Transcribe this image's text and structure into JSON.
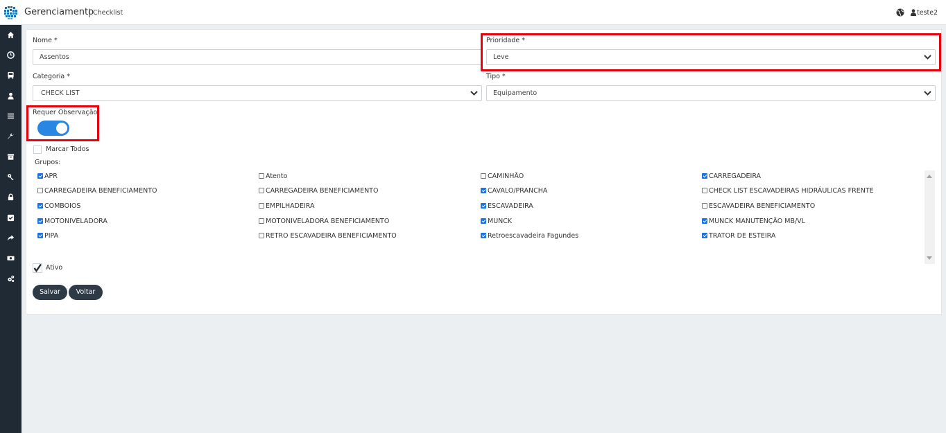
{
  "header": {
    "app_title": "Gerenciamento",
    "separator": "|",
    "breadcrumb": "Checklist",
    "user": "teste2"
  },
  "sidebar": {
    "icons": [
      "home-icon",
      "clock-icon",
      "bus-icon",
      "user-icon",
      "list-icon",
      "wrench-icon",
      "archive-icon",
      "key-icon",
      "lock-icon",
      "check-square-icon",
      "share-icon",
      "money-icon",
      "cogs-icon"
    ]
  },
  "form": {
    "nome_label": "Nome *",
    "nome_value": "Assentos",
    "prioridade_label": "Prioridade *",
    "prioridade_value": "Leve",
    "categoria_label": "Categoria *",
    "categoria_value": "CHECK LIST",
    "tipo_label": "Tipo *",
    "tipo_value": "Equipamento",
    "requer_label": "Requer Observação",
    "requer_on": true,
    "marcar_todos": "Marcar Todos",
    "grupos_label": "Grupos:",
    "ativo_label": "Ativo",
    "ativo_checked": true
  },
  "grupos": [
    {
      "label": "APR",
      "checked": true
    },
    {
      "label": "Atento",
      "checked": false
    },
    {
      "label": "CAMINHÃO",
      "checked": false
    },
    {
      "label": "CARREGADEIRA",
      "checked": true
    },
    {
      "label": "CARREGADEIRA BENEFICIAMENTO",
      "checked": false
    },
    {
      "label": "CARREGADEIRA BENEFICIAMENTO",
      "checked": false
    },
    {
      "label": "CAVALO/PRANCHA",
      "checked": true
    },
    {
      "label": "CHECK LIST ESCAVADEIRAS HIDRÁULICAS FRENTE",
      "checked": false
    },
    {
      "label": "COMBOIOS",
      "checked": true
    },
    {
      "label": "EMPILHADEIRA",
      "checked": false
    },
    {
      "label": "ESCAVADEIRA",
      "checked": true
    },
    {
      "label": "ESCAVADEIRA BENEFICIAMENTO",
      "checked": false
    },
    {
      "label": "MOTONIVELADORA",
      "checked": true
    },
    {
      "label": "MOTONIVELADORA BENEFICIAMENTO",
      "checked": false
    },
    {
      "label": "MUNCK",
      "checked": true
    },
    {
      "label": "MUNCK MANUTENÇÃO MB/VL",
      "checked": true
    },
    {
      "label": "PIPA",
      "checked": true
    },
    {
      "label": "RETRO ESCAVADEIRA BENEFICIAMENTO",
      "checked": false
    },
    {
      "label": "Retroescavadeira Fagundes",
      "checked": true
    },
    {
      "label": "TRATOR DE ESTEIRA",
      "checked": true
    }
  ],
  "buttons": {
    "save": "Salvar",
    "back": "Voltar"
  },
  "colors": {
    "sidebar": "#1f2a35",
    "toggle": "#2a86e3",
    "highlight": "#e8000d",
    "button": "#2f3a47"
  }
}
